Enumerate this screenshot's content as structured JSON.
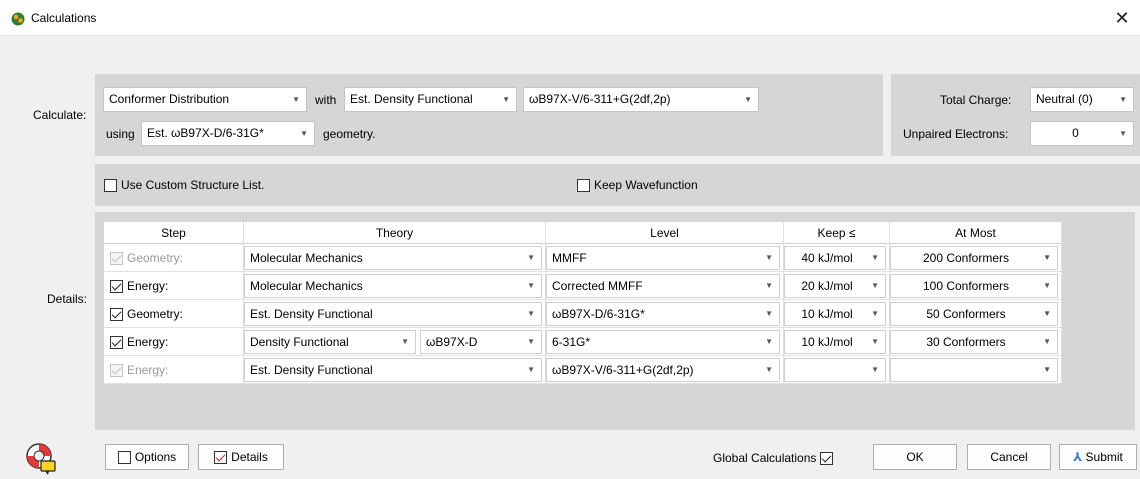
{
  "window": {
    "title": "Calculations",
    "close": "✕"
  },
  "calculate": {
    "label": "Calculate:",
    "calculation": "Conformer Distribution",
    "with_label": "with",
    "method": "Est. Density Functional",
    "basis": "ωB97X-V/6-311+G(2df,2p)",
    "using_label": "using",
    "geometry": "Est. ωB97X-D/6-31G*",
    "geometry_suffix": "geometry."
  },
  "charge": {
    "total_charge_label": "Total Charge:",
    "total_charge": "Neutral (0)",
    "unpaired_label": "Unpaired Electrons:",
    "unpaired": "0"
  },
  "options": {
    "custom_structure": "Use Custom Structure List.",
    "keep_wavefunction": "Keep Wavefunction"
  },
  "details": {
    "label": "Details:",
    "headers": [
      "Step",
      "Theory",
      "Level",
      "Keep ≤",
      "At Most"
    ],
    "rows": [
      {
        "step": "Geometry:",
        "theory": "Molecular Mechanics",
        "level": "MMFF",
        "keep": "40 kJ/mol",
        "at_most": "200 Conformers"
      },
      {
        "step": "Energy:",
        "theory": "Molecular Mechanics",
        "level": "Corrected MMFF",
        "keep": "20 kJ/mol",
        "at_most": "100 Conformers"
      },
      {
        "step": "Geometry:",
        "theory": "Est. Density Functional",
        "level": "ωB97X-D/6-31G*",
        "keep": "10 kJ/mol",
        "at_most": "50 Conformers"
      },
      {
        "step": "Energy:",
        "theory": "Density Functional",
        "functional": "ωB97X-D",
        "level": "6-31G*",
        "keep": "10 kJ/mol",
        "at_most": "30 Conformers"
      },
      {
        "step": "Energy:",
        "theory": "Est. Density Functional",
        "level": "ωB97X-V/6-311+G(2df,2p)",
        "keep": "",
        "at_most": ""
      }
    ]
  },
  "footer": {
    "options": "Options",
    "details": "Details",
    "global_calculations": "Global Calculations",
    "ok": "OK",
    "cancel": "Cancel",
    "submit": "Submit"
  },
  "icons": {
    "app": "spartan-app-icon",
    "help": "lifebuoy-help-icon",
    "submit": "submit-runner-icon",
    "dropdown": "chevron-down-icon"
  }
}
